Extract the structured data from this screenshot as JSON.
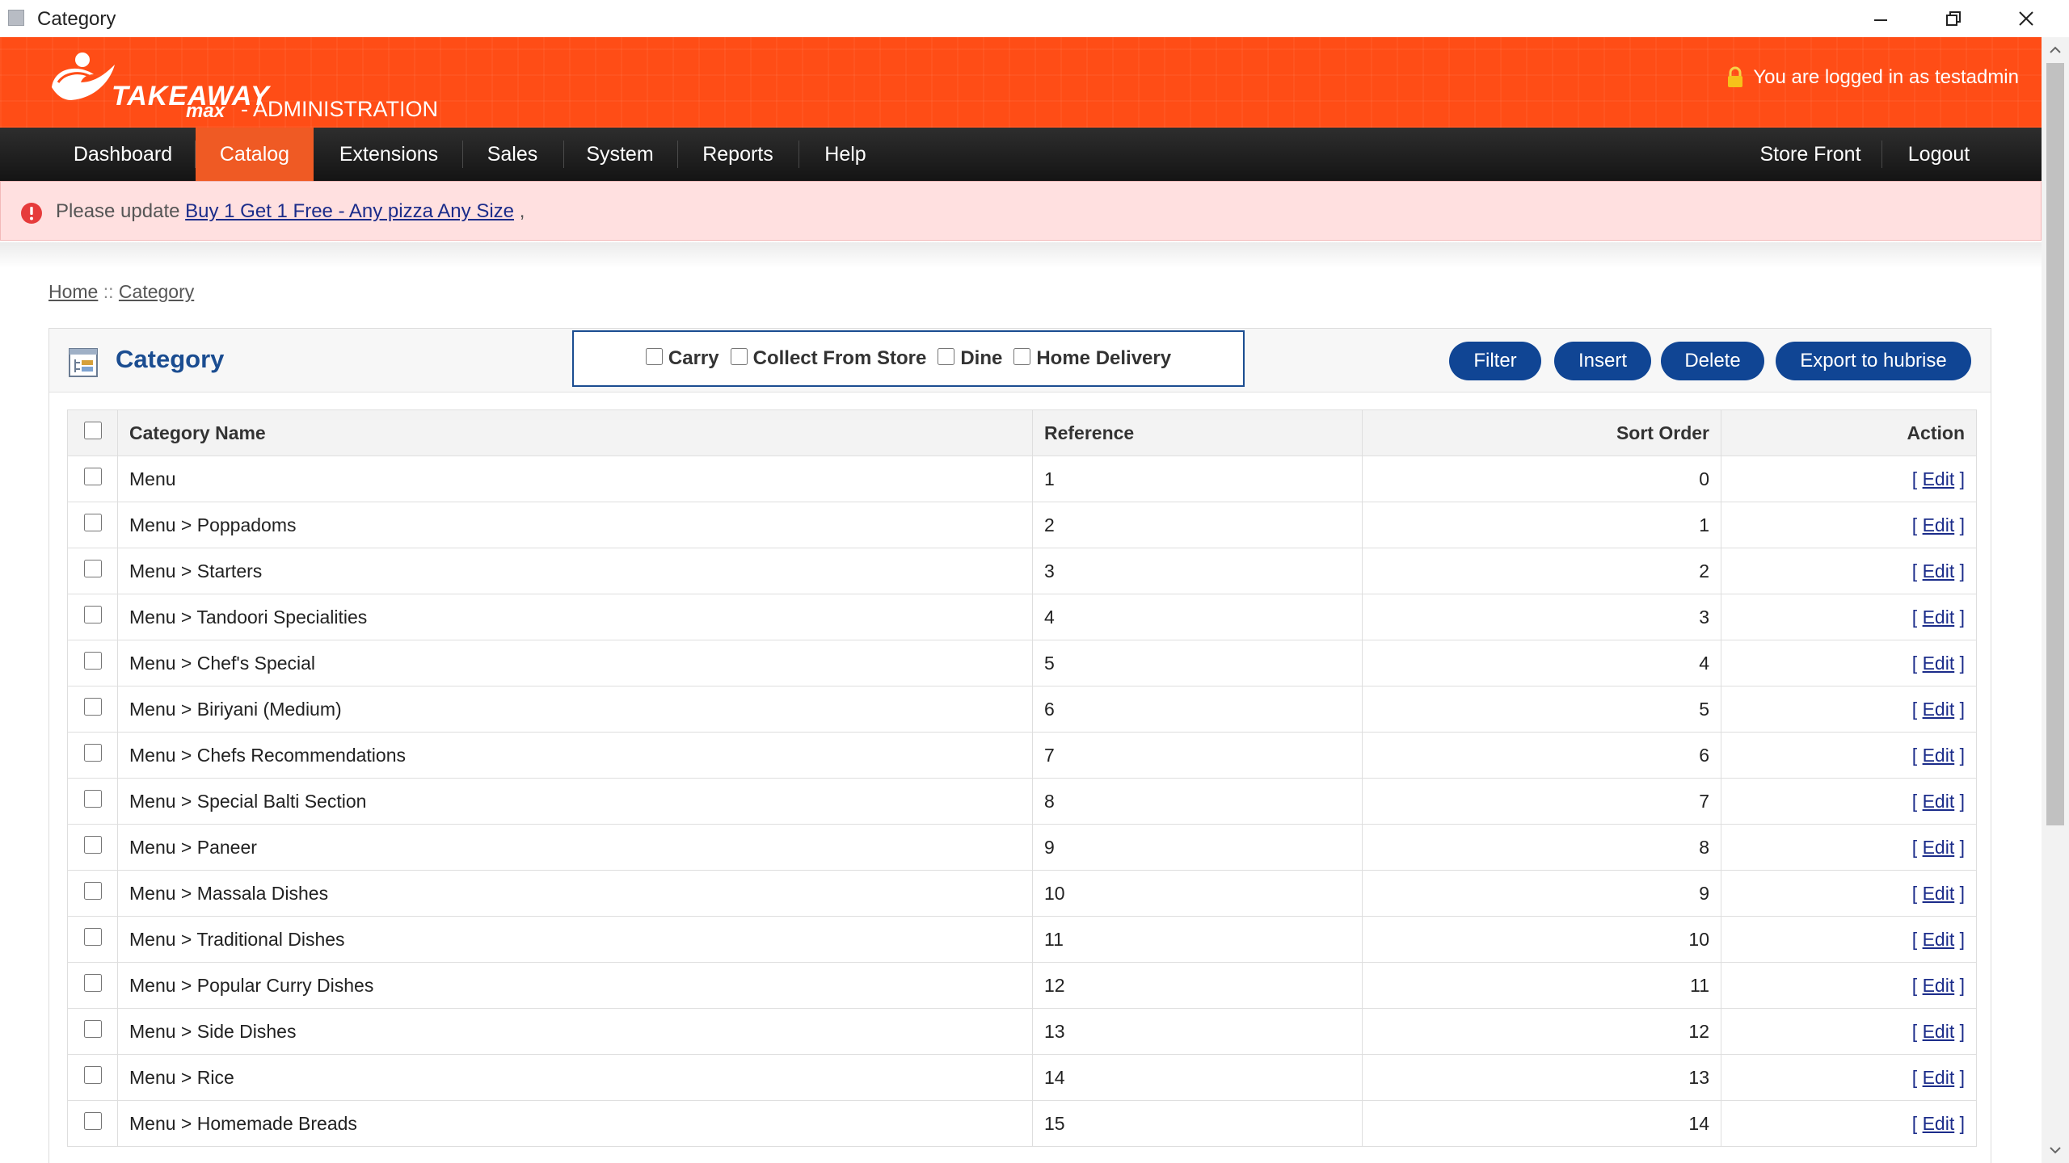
{
  "window": {
    "title": "Category"
  },
  "header": {
    "brand_take": "TAKEAWAY",
    "brand_max": "max",
    "brand_admin": "- ADMINISTRATION",
    "login_text": "You are logged in as testadmin"
  },
  "nav": {
    "items": [
      "Dashboard",
      "Catalog",
      "Extensions",
      "Sales",
      "System",
      "Reports",
      "Help"
    ],
    "active": "Catalog",
    "right": [
      "Store Front",
      "Logout"
    ]
  },
  "alert": {
    "prefix": "Please update",
    "link": "Buy 1 Get 1 Free - Any pizza Any Size",
    "suffix": ","
  },
  "breadcrumb": {
    "home": "Home",
    "separator": "::",
    "current": "Category"
  },
  "panel": {
    "title": "Category",
    "order_types": [
      "Carry",
      "Collect From Store",
      "Dine",
      "Home Delivery"
    ],
    "buttons": {
      "filter": "Filter",
      "insert": "Insert",
      "delete": "Delete",
      "export": "Export to hubrise"
    }
  },
  "table": {
    "headers": {
      "name": "Category Name",
      "reference": "Reference",
      "sort": "Sort Order",
      "action": "Action"
    },
    "edit_label": "Edit",
    "rows": [
      {
        "name": "Menu",
        "reference": "1",
        "sort": "0"
      },
      {
        "name": "Menu > Poppadoms",
        "reference": "2",
        "sort": "1"
      },
      {
        "name": "Menu > Starters",
        "reference": "3",
        "sort": "2"
      },
      {
        "name": "Menu > Tandoori Specialities",
        "reference": "4",
        "sort": "3"
      },
      {
        "name": "Menu > Chef's Special",
        "reference": "5",
        "sort": "4"
      },
      {
        "name": "Menu > Biriyani (Medium)",
        "reference": "6",
        "sort": "5"
      },
      {
        "name": "Menu > Chefs Recommendations",
        "reference": "7",
        "sort": "6"
      },
      {
        "name": "Menu > Special Balti Section",
        "reference": "8",
        "sort": "7"
      },
      {
        "name": "Menu > Paneer",
        "reference": "9",
        "sort": "8"
      },
      {
        "name": "Menu > Massala Dishes",
        "reference": "10",
        "sort": "9"
      },
      {
        "name": "Menu > Traditional Dishes",
        "reference": "11",
        "sort": "10"
      },
      {
        "name": "Menu > Popular Curry Dishes",
        "reference": "12",
        "sort": "11"
      },
      {
        "name": "Menu > Side Dishes",
        "reference": "13",
        "sort": "12"
      },
      {
        "name": "Menu > Rice",
        "reference": "14",
        "sort": "13"
      },
      {
        "name": "Menu > Homemade Breads",
        "reference": "15",
        "sort": "14"
      }
    ]
  },
  "colors": {
    "header_orange": "#ff4d16",
    "nav_active": "#ef5a24",
    "button_blue": "#104594",
    "title_blue": "#1b4d91",
    "alert_bg": "#ffe0e0"
  }
}
